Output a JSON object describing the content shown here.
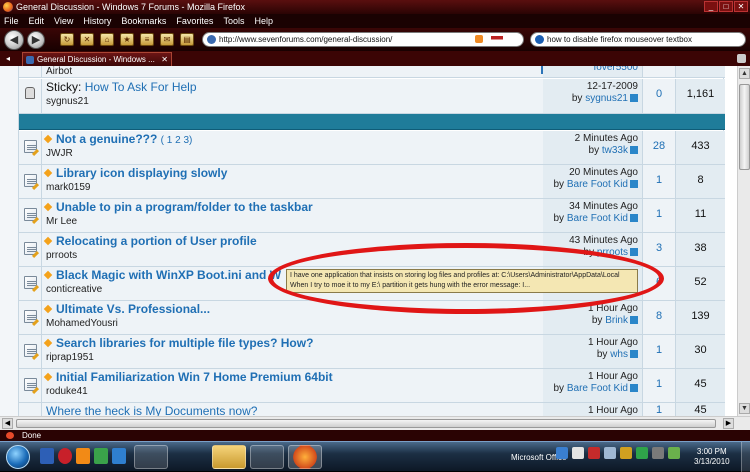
{
  "window": {
    "title": "General Discussion - Windows 7 Forums - Mozilla Firefox"
  },
  "menu": [
    "File",
    "Edit",
    "View",
    "History",
    "Bookmarks",
    "Favorites",
    "Tools",
    "Help"
  ],
  "navbar": {
    "url": "http://www.sevenforums.com/general-discussion/",
    "search": "how to disable firefox mouseover textbox"
  },
  "tab": {
    "label": "General Discussion - Windows ..."
  },
  "rows": [
    {
      "kind": "sticky-cut",
      "author": "Airbot",
      "last_user": "fover5500"
    },
    {
      "kind": "sticky",
      "prefix": "Sticky:",
      "title": "How To Ask For Help",
      "author": "sygnus21",
      "last_time": "12-17-2009",
      "by": "by",
      "last_user": "sygnus21",
      "replies": "0",
      "views": "1,161"
    },
    {
      "title": "Not a genuine???",
      "pages_label": "( 1 2 3)",
      "author": "JWJR",
      "last_time": "2 Minutes Ago",
      "by": "by",
      "last_user": "tw33k",
      "replies": "28",
      "views": "433"
    },
    {
      "title": "Library icon displaying slowly",
      "author": "mark0159",
      "last_time": "20 Minutes Ago",
      "by": "by",
      "last_user": "Bare Foot Kid",
      "replies": "1",
      "views": "8"
    },
    {
      "title": "Unable to pin a program/folder to the taskbar",
      "author": "Mr Lee",
      "last_time": "34 Minutes Ago",
      "by": "by",
      "last_user": "Bare Foot Kid",
      "replies": "1",
      "views": "11"
    },
    {
      "title": "Relocating a portion of User profile",
      "author": "prroots",
      "last_time": "43 Minutes Ago",
      "by": "by",
      "last_user": "prroots",
      "replies": "3",
      "views": "38"
    },
    {
      "title": "Black Magic with WinXP Boot.ini and W",
      "author": "conticreative",
      "last_time": "",
      "by": "",
      "last_user": "",
      "replies": "6",
      "views": "52"
    },
    {
      "title": "Ultimate Vs. Professional...",
      "author": "MohamedYousri",
      "last_time": "1 Hour Ago",
      "by": "by",
      "last_user": "Brink",
      "replies": "8",
      "views": "139"
    },
    {
      "title": "Search libraries for multiple file types? How?",
      "author": "riprap1951",
      "last_time": "1 Hour Ago",
      "by": "by",
      "last_user": "whs",
      "replies": "1",
      "views": "30"
    },
    {
      "title": "Initial Familiarization Win 7 Home Premium 64bit",
      "author": "roduke41",
      "last_time": "1 Hour Ago",
      "by": "by",
      "last_user": "Bare Foot Kid",
      "replies": "1",
      "views": "45"
    },
    {
      "title": "Where the heck is My Documents now?",
      "author": "",
      "last_time": "1 Hour Ago",
      "by": "",
      "last_user": "",
      "replies": "1",
      "views": "45"
    }
  ],
  "tooltip": {
    "line1": "I have one application that insists on storing log files and profiles at: C:\\Users\\Administrator\\AppData\\Local",
    "line2": "When I try to moe it to my E:\\ partition it gets hung with the error message:   I..."
  },
  "status": {
    "text": "Done"
  },
  "taskbar": {
    "office": "Microsoft Office",
    "time": "3:00 PM",
    "date": "3/13/2010"
  },
  "colors": {
    "accent_red": "#e01616",
    "link_blue": "#1f6fb4",
    "header_teal": "#1f7c9a",
    "prefix_orange": "#f4a21b"
  }
}
